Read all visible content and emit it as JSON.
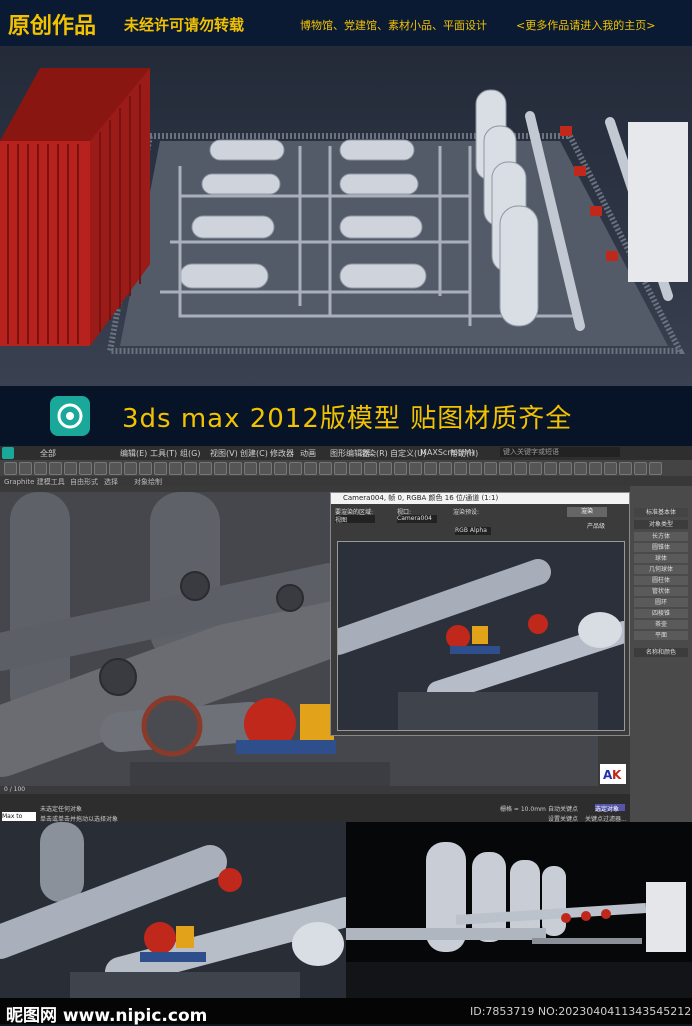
{
  "top_banner": {
    "title": "原创作品",
    "notice": "未经许可请勿转载",
    "categories": "博物馆、党建馆、素材小品、平面设计",
    "more": "<更多作品请进入我的主页>"
  },
  "band": {
    "headline": "3ds max 2012版模型  贴图材质齐全"
  },
  "max_window": {
    "search_placeholder": "键入关键字或短语",
    "select_filter": "全部",
    "menu_items": [
      "编辑(E)",
      "工具(T)",
      "组(G)",
      "视图(V)",
      "创建(C)",
      "修改器",
      "动画",
      "图形编辑器",
      "渲染(R)",
      "自定义(U)",
      "MAXScript(M)",
      "帮助(H)"
    ],
    "subtab_label": "Graphite 建模工具",
    "subtab_2": "自由形式",
    "subtab_3": "选择",
    "subtab_4": "对象绘制",
    "render_window": {
      "title": "Camera004, 帧 0, RGBA 颜色 16 位/通道 (1:1)",
      "area_label": "要渲染的区域:",
      "area_value": "视图",
      "viewport_label": "视口:",
      "viewport_value": "Camera004",
      "preset_label": "渲染预设:",
      "render_button": "渲染",
      "product_label": "产品级",
      "channel_value": "RGB Alpha"
    },
    "command_panel": {
      "object_type": "对象类型",
      "standard": "标准基本体",
      "buttons": [
        "长方体",
        "圆锥体",
        "球体",
        "几何球体",
        "圆柱体",
        "管状体",
        "圆环",
        "四棱锥",
        "茶壶",
        "平面"
      ],
      "name_color": "名称和颜色"
    },
    "timeline": {
      "frame": "0 / 100",
      "status": "未选定任何对象",
      "prompt": "单击或单击并拖动以选择对象",
      "grid": "栅格 = 10.0mm",
      "autokey": "自动关键点",
      "selected": "选定对象",
      "setkey": "设置关键点",
      "keyfilter": "关键点过滤器..."
    },
    "script_label": "Max to Physx"
  },
  "footer": {
    "logo": "昵图网 www.nipic.com",
    "id_text": "ID:7853719 NO:20230404113435452128"
  },
  "colors": {
    "banner_bg": "#0a1a33",
    "accent_yellow": "#f2c200",
    "container_red": "#b8221e",
    "pump_red": "#c0281c",
    "max_logo_teal": "#1aa89a"
  }
}
